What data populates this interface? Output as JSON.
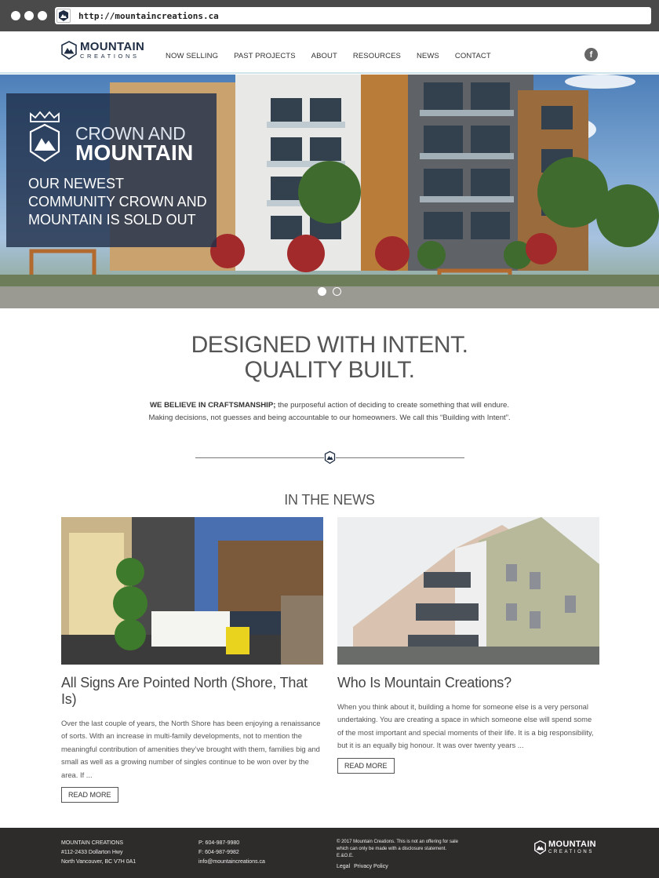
{
  "browser": {
    "url": "http://mountaincreations.ca"
  },
  "brand": {
    "name": "MOUNTAIN",
    "sub": "CREATIONS"
  },
  "nav": {
    "items": [
      "NOW SELLING",
      "PAST PROJECTS",
      "ABOUT",
      "RESOURCES",
      "NEWS",
      "CONTACT"
    ],
    "facebook": "f"
  },
  "hero": {
    "title_line1": "CROWN AND",
    "title_line2": "MOUNTAIN",
    "body": "OUR NEWEST COMMUNITY CROWN AND MOUNTAIN IS SOLD OUT"
  },
  "intro": {
    "title_line1": "DESIGNED WITH INTENT.",
    "title_line2": "QUALITY BUILT.",
    "lead": "WE BELIEVE IN CRAFTSMANSHIP;",
    "text1": " the purposeful action of deciding to create something that will endure.",
    "text2": "Making decisions, not guesses and being accountable to our homeowners. We call this “Building with Intent”."
  },
  "news": {
    "heading": "IN THE NEWS",
    "articles": [
      {
        "title": "All Signs Are Pointed North (Shore, That Is)",
        "excerpt": "Over the last couple of years, the North Shore has been enjoying a renaissance of sorts. With an increase in multi-family developments, not to mention the meaningful contribution of amenities they’ve brought with them, families big and small as well as a growing number of singles continue to be won over by the area. If ...",
        "button": "READ MORE"
      },
      {
        "title": "Who Is Mountain Creations?",
        "excerpt": "When you think about it, building a home for someone else is a very personal undertaking. You are creating a space in which someone else will spend some of the most important and special moments of their life. It is a big responsibility, but it is an equally big honour. It was over twenty years ...",
        "button": "READ MORE"
      }
    ]
  },
  "footer": {
    "company": "MOUNTAIN CREATIONS",
    "address1": "#112-2433 Dollarton Hwy",
    "address2": "North Vancouver, BC V7H 0A1",
    "phone": "P: 604-987-9980",
    "fax": "F: 604-987-9982",
    "email": "info@mountaincreations.ca",
    "legal": "© 2017 Mountain Creations. This is not an offering for sale which can only be made with a disclosure statement. E.&O.E.",
    "link_legal": "Legal",
    "link_privacy": "Privacy Policy"
  },
  "colors": {
    "brand_navy": "#1f2e44",
    "hero_panel": "#20304a",
    "footer_bg": "#2e2c2b"
  }
}
